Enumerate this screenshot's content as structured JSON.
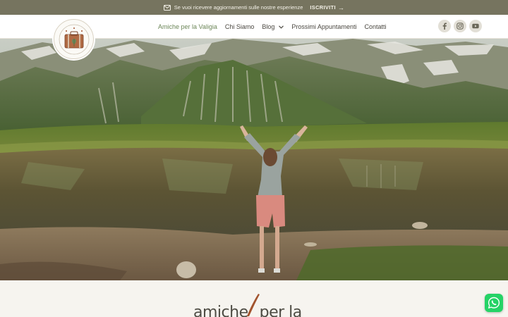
{
  "topbar": {
    "notice": "Se vuoi ricevere aggiornamenti sulle nostre esperienze",
    "subscribe_label": "ISCRIVITI",
    "mail_icon": "envelope-icon",
    "arrow": "→"
  },
  "header": {
    "logo_icon": "suitcase-logo-icon",
    "nav": [
      {
        "label": "Amiche per la Valigia",
        "active": true
      },
      {
        "label": "Chi Siamo"
      },
      {
        "label": "Blog",
        "has_dropdown": true
      },
      {
        "label": "Prossimi Appuntamenti"
      },
      {
        "label": "Contatti"
      }
    ],
    "socials": [
      "facebook-icon",
      "instagram-icon",
      "youtube-icon"
    ]
  },
  "hero": {
    "description_icon": "mountain-lake-photo"
  },
  "lower": {
    "brand_text_1": "amiche",
    "brand_text_2": "per la"
  },
  "whatsapp": {
    "icon": "whatsapp-icon"
  },
  "colors": {
    "topbar_bg": "#76745f",
    "active_nav": "#6d8759",
    "social_bg": "#e2dfd6",
    "whatsapp": "#25d366",
    "brand_stroke": "#a2542e"
  }
}
